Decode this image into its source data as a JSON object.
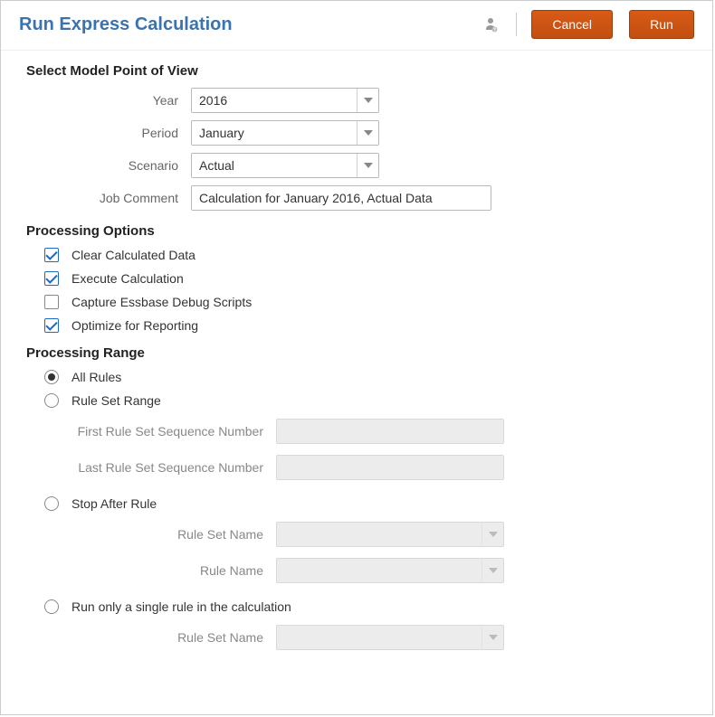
{
  "header": {
    "title": "Run Express Calculation",
    "cancel_label": "Cancel",
    "run_label": "Run"
  },
  "pov": {
    "heading": "Select Model Point of View",
    "year_label": "Year",
    "year_value": "2016",
    "period_label": "Period",
    "period_value": "January",
    "scenario_label": "Scenario",
    "scenario_value": "Actual",
    "comment_label": "Job Comment",
    "comment_value": "Calculation for January 2016, Actual Data"
  },
  "processing_options": {
    "heading": "Processing Options",
    "items": [
      {
        "label": "Clear Calculated Data",
        "checked": true
      },
      {
        "label": "Execute Calculation",
        "checked": true
      },
      {
        "label": "Capture Essbase Debug Scripts",
        "checked": false
      },
      {
        "label": "Optimize for Reporting",
        "checked": true
      }
    ]
  },
  "processing_range": {
    "heading": "Processing Range",
    "all_rules_label": "All Rules",
    "rule_set_range_label": "Rule Set Range",
    "first_seq_label": "First Rule Set Sequence Number",
    "last_seq_label": "Last Rule Set Sequence Number",
    "stop_after_label": "Stop After Rule",
    "stop_rule_set_label": "Rule Set Name",
    "stop_rule_name_label": "Rule Name",
    "single_rule_label": "Run only a single rule in the calculation",
    "single_rule_set_label": "Rule Set Name"
  }
}
